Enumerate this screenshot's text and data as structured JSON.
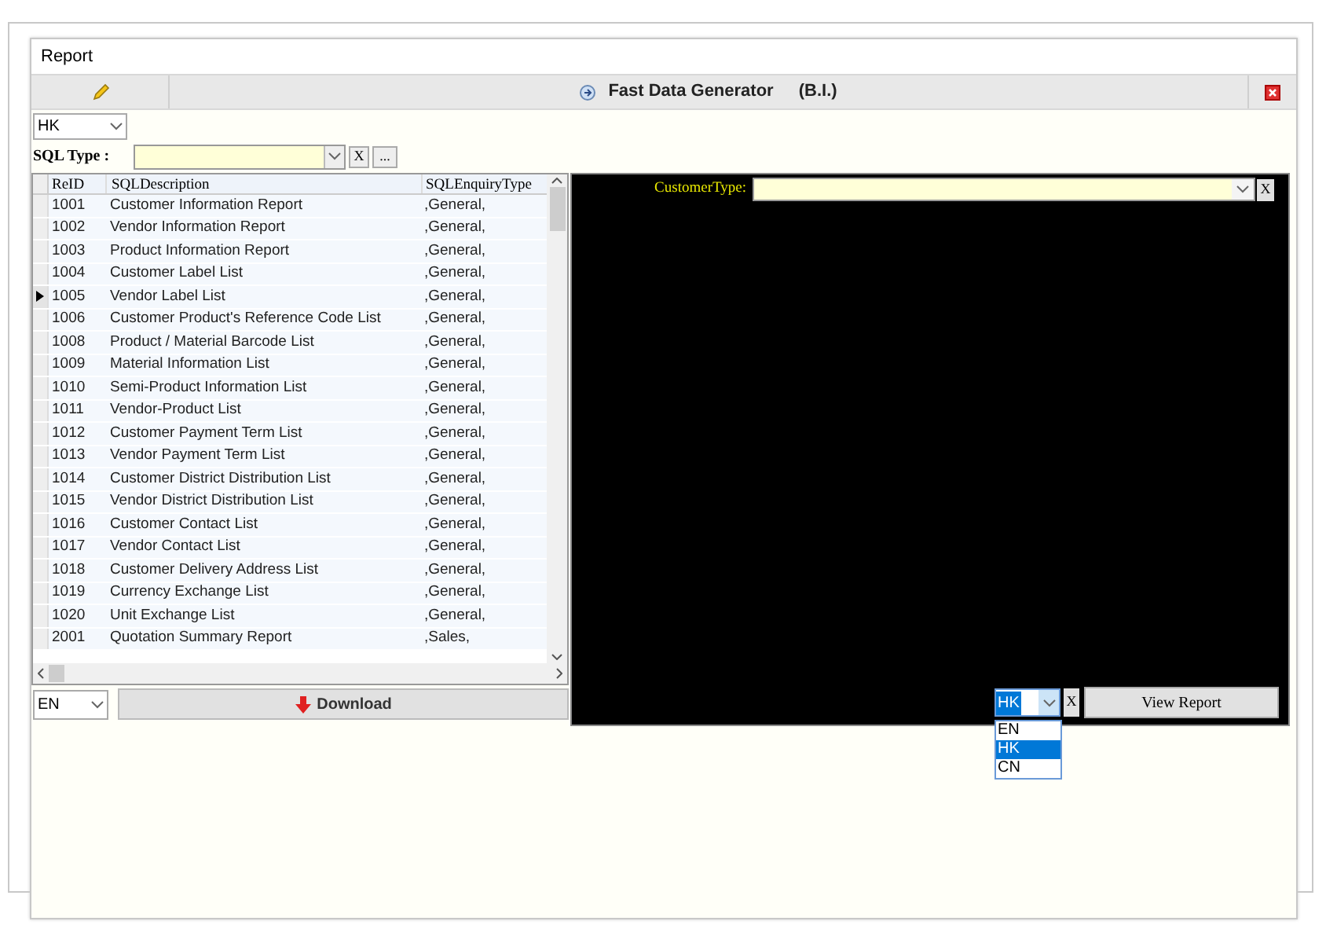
{
  "window": {
    "title": "Report"
  },
  "toolbar": {
    "title": "Fast Data Generator",
    "subtitle": "(B.I.)"
  },
  "region_select": {
    "value": "HK"
  },
  "sql_type": {
    "label": "SQL Type :",
    "clear": "X",
    "browse": "..."
  },
  "grid": {
    "columns": [
      "ReID",
      "SQLDescription",
      "SQLEnquiryType"
    ],
    "rows": [
      {
        "cells": [
          "1001",
          "Customer Information Report",
          ",General,"
        ],
        "selected": false
      },
      {
        "cells": [
          "1002",
          "Vendor Information Report",
          ",General,"
        ],
        "selected": false
      },
      {
        "cells": [
          "1003",
          "Product Information Report",
          ",General,"
        ],
        "selected": false
      },
      {
        "cells": [
          "1004",
          "Customer Label List",
          ",General,"
        ],
        "selected": false
      },
      {
        "cells": [
          "1005",
          "Vendor Label List",
          ",General,"
        ],
        "selected": true
      },
      {
        "cells": [
          "1006",
          "Customer Product's Reference Code List",
          ",General,"
        ],
        "selected": false
      },
      {
        "cells": [
          "1008",
          "Product / Material Barcode List",
          ",General,"
        ],
        "selected": false
      },
      {
        "cells": [
          "1009",
          "Material Information List",
          ",General,"
        ],
        "selected": false
      },
      {
        "cells": [
          "1010",
          "Semi-Product Information List",
          ",General,"
        ],
        "selected": false
      },
      {
        "cells": [
          "1011",
          "Vendor-Product List",
          ",General,"
        ],
        "selected": false
      },
      {
        "cells": [
          "1012",
          "Customer Payment Term List",
          ",General,"
        ],
        "selected": false
      },
      {
        "cells": [
          "1013",
          "Vendor Payment Term List",
          ",General,"
        ],
        "selected": false
      },
      {
        "cells": [
          "1014",
          "Customer District Distribution List",
          ",General,"
        ],
        "selected": false
      },
      {
        "cells": [
          "1015",
          "Vendor District Distribution List",
          ",General,"
        ],
        "selected": false
      },
      {
        "cells": [
          "1016",
          "Customer Contact List",
          ",General,"
        ],
        "selected": false
      },
      {
        "cells": [
          "1017",
          "Vendor Contact List",
          ",General,"
        ],
        "selected": false
      },
      {
        "cells": [
          "1018",
          "Customer Delivery Address List",
          ",General,"
        ],
        "selected": false
      },
      {
        "cells": [
          "1019",
          "Currency Exchange List",
          ",General,"
        ],
        "selected": false
      },
      {
        "cells": [
          "1020",
          "Unit Exchange List",
          ",General,"
        ],
        "selected": false
      },
      {
        "cells": [
          "2001",
          "Quotation Summary Report",
          ",Sales,"
        ],
        "selected": false
      }
    ]
  },
  "download_language": {
    "value": "EN"
  },
  "download_button": "Download",
  "filter_panel": {
    "customer_type_label": "CustomerType:",
    "clear": "X"
  },
  "report_language": {
    "value": "HK",
    "clear": "X",
    "expanded": true,
    "options": [
      {
        "label": "EN",
        "selected": false
      },
      {
        "label": "HK",
        "selected": true
      },
      {
        "label": "CN",
        "selected": false
      }
    ]
  },
  "view_report_button": "View Report"
}
